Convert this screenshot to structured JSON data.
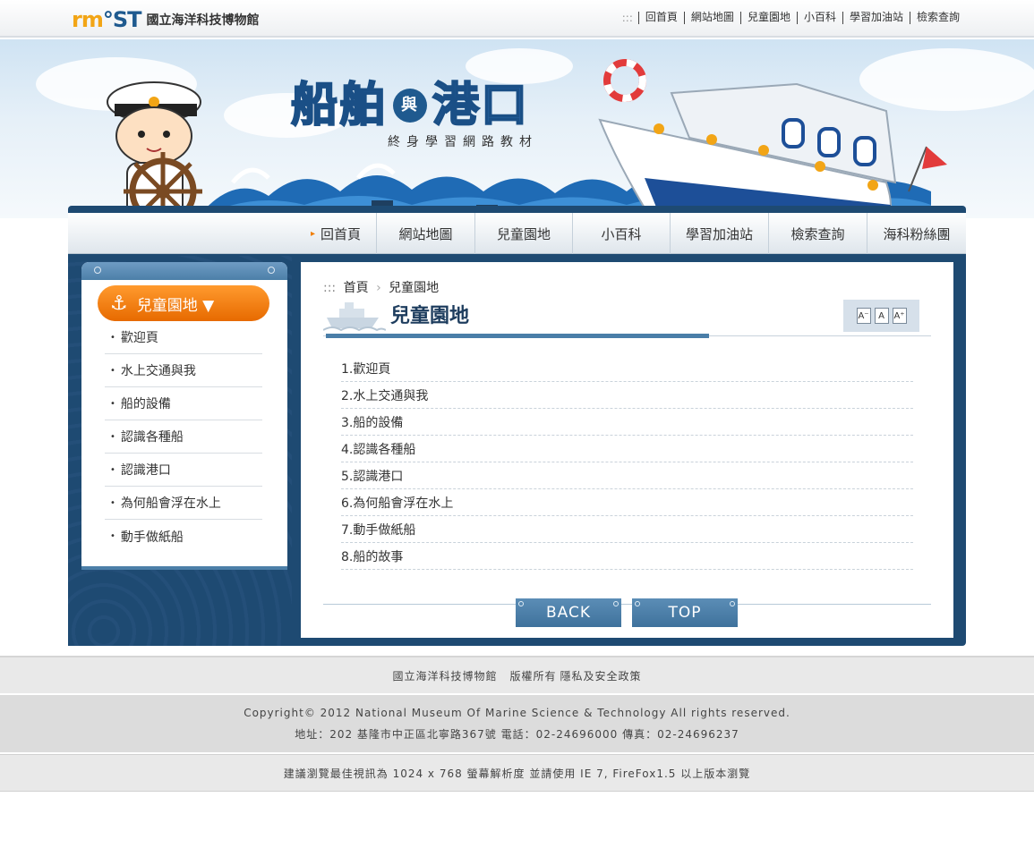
{
  "header": {
    "logo_mark_a": "rm",
    "logo_mark_b": "ST",
    "logo_mark_c": "°",
    "site_name": "國立海洋科技博物館",
    "links_prefix": ":::",
    "links": [
      "回首頁",
      "網站地圖",
      "兒童園地",
      "小百科",
      "學習加油站",
      "檢索查詢"
    ]
  },
  "banner": {
    "title_part1": "船舶",
    "title_and": "與",
    "title_part2": "港口",
    "subtitle": "終身學習網路教材"
  },
  "nav": {
    "items": [
      "回首頁",
      "網站地圖",
      "兒童園地",
      "小百科",
      "學習加油站",
      "檢索查詢",
      "海科粉絲團"
    ],
    "active_marker": "▸"
  },
  "sidebar": {
    "title": "兒童園地 ▼",
    "anchor_symbol": "⚓",
    "items": [
      "歡迎頁",
      "水上交通與我",
      "船的設備",
      "認識各種船",
      "認識港口",
      "為何船會浮在水上",
      "動手做紙船"
    ]
  },
  "content": {
    "breadcrumb_prefix": ":::",
    "breadcrumb": [
      "首頁",
      "兒童園地"
    ],
    "breadcrumb_sep": "›",
    "title": "兒童園地",
    "font_buttons": [
      "A⁻",
      "A",
      "A⁺"
    ],
    "list": [
      "1.歡迎頁",
      "2.水上交通與我",
      "3.船的設備",
      "4.認識各種船",
      "5.認識港口",
      "6.為何船會浮在水上",
      "7.動手做紙船",
      "8.船的故事"
    ],
    "back_label": "BACK",
    "top_label": "TOP"
  },
  "footer": {
    "links": [
      "國立海洋科技博物館",
      "版權所有",
      "隱私及安全政策"
    ],
    "copyright": "Copyright© 2012 National Museum Of Marine Science & Technology All rights reserved.",
    "address": "地址：202 基隆市中正區北寧路367號 電話：02-24696000 傳真：02-24696237",
    "browser_note": "建議瀏覽最佳視訊為 1024 x 768 螢幕解析度 並請使用 IE 7, FireFox1.5 以上版本瀏覽"
  },
  "colors": {
    "brand_blue": "#1e4a72",
    "accent_orange": "#f07d00",
    "button_blue": "#4a7ea8"
  }
}
